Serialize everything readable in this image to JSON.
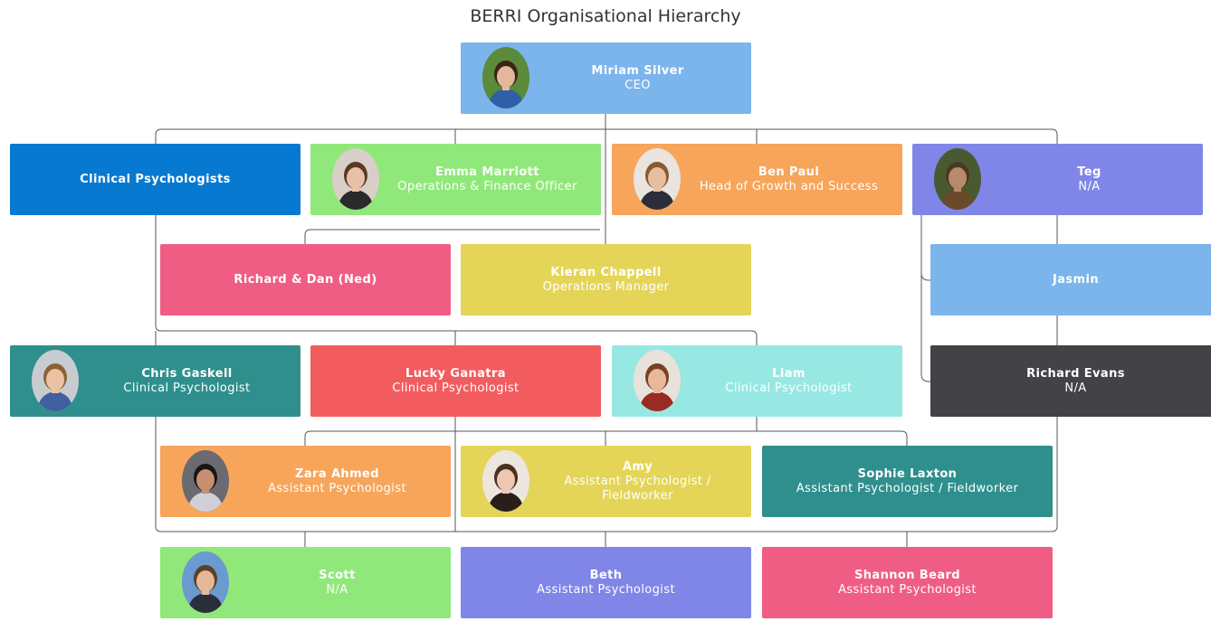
{
  "title": "BERRI Organisational Hierarchy",
  "colors": {
    "line": "#555555",
    "light_blue": "#7cb4ec",
    "blue": "#0779d1",
    "green": "#90e87a",
    "orange": "#f6a55b",
    "purple": "#8086e8",
    "pink": "#f05d84",
    "yellow": "#e4d558",
    "teal": "#2f8f8d",
    "red": "#f35c5f",
    "aqua": "#97e8e3",
    "dark": "#434347"
  },
  "nodes": [
    {
      "id": "miriam",
      "name": "Miriam Silver",
      "role": "CEO",
      "color": "light_blue",
      "avatar": "woman-dark-hair",
      "text": "#ffffff"
    },
    {
      "id": "clinpsych",
      "name": "Clinical Psychologists",
      "role": "",
      "color": "blue",
      "avatar": "",
      "text": "#ffffff"
    },
    {
      "id": "emma",
      "name": "Emma Marriott",
      "role": "Operations & Finance Officer",
      "color": "green",
      "avatar": "woman-long-hair",
      "text": "#ffffff"
    },
    {
      "id": "ben",
      "name": "Ben Paul",
      "role": "Head of Growth and Success",
      "color": "orange",
      "avatar": "man-beard-glasses",
      "text": "#ffffff"
    },
    {
      "id": "teg",
      "name": "Teg",
      "role": "N/A",
      "color": "purple",
      "avatar": "person-outdoors",
      "text": "#ffffff"
    },
    {
      "id": "richdan",
      "name": "Richard & Dan (Ned)",
      "role": "",
      "color": "pink",
      "avatar": "",
      "text": "#ffffff"
    },
    {
      "id": "kieran",
      "name": "Kieran Chappell",
      "role": "Operations Manager",
      "color": "yellow",
      "avatar": "",
      "text": "#ffffff"
    },
    {
      "id": "jasmin",
      "name": "Jasmin",
      "role": "",
      "color": "light_blue",
      "avatar": "",
      "text": "#ffffff"
    },
    {
      "id": "chris",
      "name": "Chris Gaskell",
      "role": "Clinical Psychologist",
      "color": "teal",
      "avatar": "man-short-hair",
      "text": "#ffffff"
    },
    {
      "id": "lucky",
      "name": "Lucky Ganatra",
      "role": "Clinical Psychologist",
      "color": "red",
      "avatar": "",
      "text": "#ffffff"
    },
    {
      "id": "liam",
      "name": "Liam",
      "role": "Clinical Psychologist",
      "color": "aqua",
      "avatar": "man-beard-glasses-2",
      "text": "#ffffff"
    },
    {
      "id": "richard",
      "name": "Richard Evans",
      "role": "N/A",
      "color": "dark",
      "avatar": "",
      "text": "#ffffff"
    },
    {
      "id": "zara",
      "name": "Zara Ahmed",
      "role": "Assistant Psychologist",
      "color": "orange",
      "avatar": "woman-dark-long-hair",
      "text": "#ffffff"
    },
    {
      "id": "amy",
      "name": "Amy",
      "role": "Assistant Psychologist / Fieldworker",
      "color": "yellow",
      "avatar": "woman-brown-hair",
      "text": "#ffffff"
    },
    {
      "id": "sophie",
      "name": "Sophie Laxton",
      "role": "Assistant Psychologist / Fieldworker",
      "color": "teal",
      "avatar": "",
      "text": "#ffffff"
    },
    {
      "id": "scott",
      "name": "Scott",
      "role": "N/A",
      "color": "green",
      "avatar": "man-lake",
      "text": "#ffffff"
    },
    {
      "id": "beth",
      "name": "Beth",
      "role": "Assistant Psychologist",
      "color": "purple",
      "avatar": "",
      "text": "#ffffff"
    },
    {
      "id": "shannon",
      "name": "Shannon Beard",
      "role": "Assistant Psychologist",
      "color": "pink",
      "avatar": "",
      "text": "#ffffff"
    }
  ]
}
